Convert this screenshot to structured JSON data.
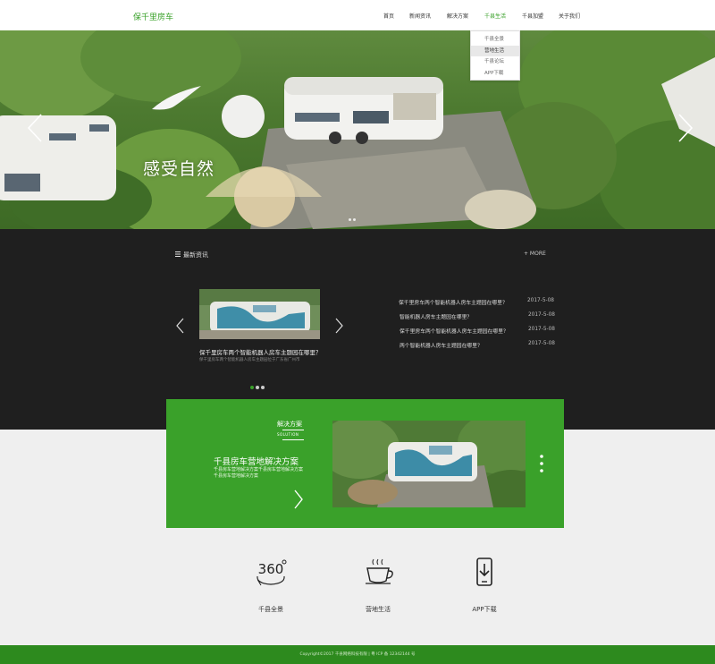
{
  "header": {
    "logo": "保千里房车",
    "nav": [
      {
        "label": "首页",
        "active": false
      },
      {
        "label": "新闻资讯",
        "active": false
      },
      {
        "label": "解决方案",
        "active": false
      },
      {
        "label": "千县生活",
        "active": true
      },
      {
        "label": "千县加盟",
        "active": false
      },
      {
        "label": "关于我们",
        "active": false
      }
    ],
    "dropdown": [
      {
        "label": "千县全景",
        "highlighted": false
      },
      {
        "label": "营地生活",
        "highlighted": true
      },
      {
        "label": "千县论坛",
        "highlighted": false
      },
      {
        "label": "APP下载",
        "highlighted": false
      }
    ]
  },
  "banner": {
    "title": "感受自然",
    "slides_total": 2,
    "slide_active": 1
  },
  "news": {
    "section_title": "最新资讯",
    "more": "+ MORE",
    "featured": {
      "caption": "保千里房车两个智能机器人房车主题园在哪里？",
      "subcaption": "保千里房车两个智能机器人房车主题园位于广东省广州市"
    },
    "carousel_dots": 3,
    "carousel_active": 0,
    "items": [
      {
        "title": "保千里房车两个智能机器人房车主题园在哪里？",
        "date": "2017-5-08"
      },
      {
        "title": "智能机器人房车主题园在哪里？",
        "date": "2017-5-08"
      },
      {
        "title": "保千里房车两个智能机器人房车主题园在哪里？",
        "date": "2017-5-08"
      },
      {
        "title": "两个智能机器人房车主题园在哪里？",
        "date": "2017-5-08"
      }
    ]
  },
  "solution": {
    "label": "解决方案",
    "label_en": "SOLUTION",
    "title": "千县房车营地解决方案",
    "description": "千县房车营地解决方案千县房车营地解决方案千县房车营地解决方案"
  },
  "features": [
    {
      "label": "千县全景",
      "icon": "360-view-icon"
    },
    {
      "label": "营地生活",
      "icon": "coffee-cup-icon"
    },
    {
      "label": "APP下载",
      "icon": "phone-download-icon"
    }
  ],
  "footer": {
    "text": "Copyright©2017 千县网络科技有限 | 粤 ICP 备 12342144 号"
  },
  "colors": {
    "brand_green": "#3aa12a",
    "footer_green": "#2d8a1e",
    "news_bg": "#1f1f1f"
  }
}
